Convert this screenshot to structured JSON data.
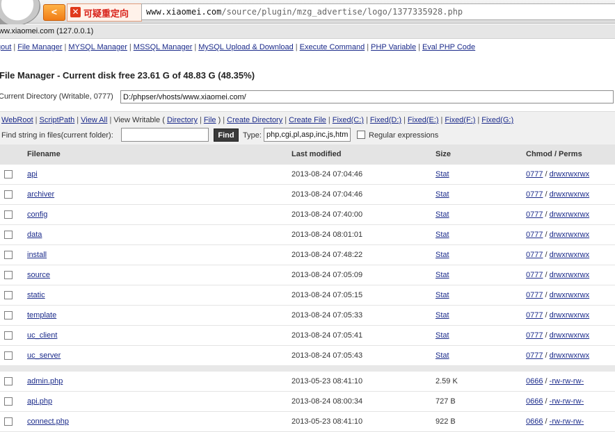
{
  "browser": {
    "back_glyph": "<",
    "warning_glyph": "✕",
    "warning_label": "可疑重定向",
    "url_host": "www.xiaomei.com",
    "url_path": "/source/plugin/mzg_advertise/logo/1377335928.php"
  },
  "site": {
    "host_line": "ww.xiaomei.com (127.0.0.1)",
    "menu": [
      "gout",
      "File Manager",
      "MYSQL Manager",
      "MSSQL Manager",
      "MySQL Upload & Download",
      "Execute Command",
      "PHP Variable",
      "Eval PHP Code"
    ],
    "title": "File Manager - Current disk free 23.61 G of 48.83 G (48.35%)",
    "current_directory_label": "Current Directory (Writable, 0777)",
    "current_directory_value": "D:/phpser/vhosts/www.xiaomei.com/"
  },
  "toolbar": {
    "webroot": "WebRoot",
    "scriptpath": "ScriptPath",
    "view_all": "View All",
    "view_writable_prefix": "View Writable (",
    "directory": "Directory",
    "file": "File",
    "view_writable_suffix": ")",
    "create_directory": "Create Directory",
    "create_file": "Create File",
    "fixed_c": "Fixed(C:)",
    "fixed_d": "Fixed(D:)",
    "fixed_e": "Fixed(E:)",
    "fixed_f": "Fixed(F:)",
    "fixed_g": "Fixed(G:)",
    "find_label": "Find string in files(current folder):",
    "find_value": "",
    "find_button": "Find",
    "type_label": "Type:",
    "type_value": "php,cgi,pl,asp,inc,js,htm",
    "regex_label": "Regular expressions"
  },
  "table": {
    "headers": {
      "filename": "Filename",
      "last_modified": "Last modified",
      "size": "Size",
      "chmod": "Chmod / Perms"
    },
    "directories": [
      {
        "name": "api",
        "modified": "2013-08-24 07:04:46",
        "size": "Stat",
        "chmod": "0777",
        "perms": "drwxrwxrwx"
      },
      {
        "name": "archiver",
        "modified": "2013-08-24 07:04:46",
        "size": "Stat",
        "chmod": "0777",
        "perms": "drwxrwxrwx"
      },
      {
        "name": "config",
        "modified": "2013-08-24 07:40:00",
        "size": "Stat",
        "chmod": "0777",
        "perms": "drwxrwxrwx"
      },
      {
        "name": "data",
        "modified": "2013-08-24 08:01:01",
        "size": "Stat",
        "chmod": "0777",
        "perms": "drwxrwxrwx"
      },
      {
        "name": "install",
        "modified": "2013-08-24 07:48:22",
        "size": "Stat",
        "chmod": "0777",
        "perms": "drwxrwxrwx"
      },
      {
        "name": "source",
        "modified": "2013-08-24 07:05:09",
        "size": "Stat",
        "chmod": "0777",
        "perms": "drwxrwxrwx"
      },
      {
        "name": "static",
        "modified": "2013-08-24 07:05:15",
        "size": "Stat",
        "chmod": "0777",
        "perms": "drwxrwxrwx"
      },
      {
        "name": "template",
        "modified": "2013-08-24 07:05:33",
        "size": "Stat",
        "chmod": "0777",
        "perms": "drwxrwxrwx"
      },
      {
        "name": "uc_client",
        "modified": "2013-08-24 07:05:41",
        "size": "Stat",
        "chmod": "0777",
        "perms": "drwxrwxrwx"
      },
      {
        "name": "uc_server",
        "modified": "2013-08-24 07:05:43",
        "size": "Stat",
        "chmod": "0777",
        "perms": "drwxrwxrwx"
      }
    ],
    "files": [
      {
        "name": "admin.php",
        "modified": "2013-05-23 08:41:10",
        "size": "2.59 K",
        "chmod": "0666",
        "perms": "-rw-rw-rw-"
      },
      {
        "name": "api.php",
        "modified": "2013-08-24 08:00:34",
        "size": "727 B",
        "chmod": "0666",
        "perms": "-rw-rw-rw-"
      },
      {
        "name": "connect.php",
        "modified": "2013-05-23 08:41:10",
        "size": "922 B",
        "chmod": "0666",
        "perms": "-rw-rw-rw-"
      }
    ]
  }
}
